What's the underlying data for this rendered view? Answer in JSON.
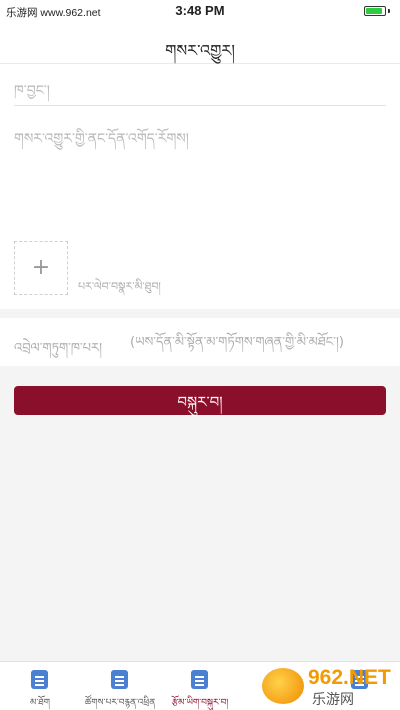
{
  "status_bar": {
    "carrier": "乐游网 www.962.net",
    "time": "3:48 PM",
    "battery_level": 0.9,
    "battery_color": "#2ecc40"
  },
  "nav": {
    "title": "གསར་འགྱུར།"
  },
  "form": {
    "title_placeholder": "ཁ་བྱང་།",
    "content_placeholder": "གསར་འགྱུར་གྱི་ནང་དོན་འགོད་རོགས།",
    "upload_icon": "plus-icon",
    "upload_hint": "པར་ལེབ་བསྣར་མི་ཐུབ།"
  },
  "contact": {
    "label": "འབྲེལ་གཏུག་ཁ་པར།",
    "placeholder": "(ཡས་དོན་མི་སྟོན་མ་གཏོགས་གཞན་གྱི་མི་མཐོང་།)"
  },
  "submit": {
    "label": "བསྐུར་བ།",
    "color": "#8a0f2a"
  },
  "tabs": [
    {
      "label": "མ་ཐོག",
      "icon": "document-icon",
      "active": false
    },
    {
      "label": "ཚོགས་པར་བརྙན་འཕྲིན",
      "icon": "document-icon",
      "active": false
    },
    {
      "label": "རྩོམ་ཡིག་བསྐུར་བ།",
      "icon": "document-icon",
      "active": true
    },
    {
      "label": "",
      "icon": "document-icon",
      "active": false
    },
    {
      "label": "",
      "icon": "document-icon",
      "active": false
    }
  ],
  "watermark": {
    "brand": "962.NET",
    "sub": "乐游网"
  },
  "colors": {
    "accent": "#8a0f2a",
    "tab_icon": "#4a7fd1"
  }
}
